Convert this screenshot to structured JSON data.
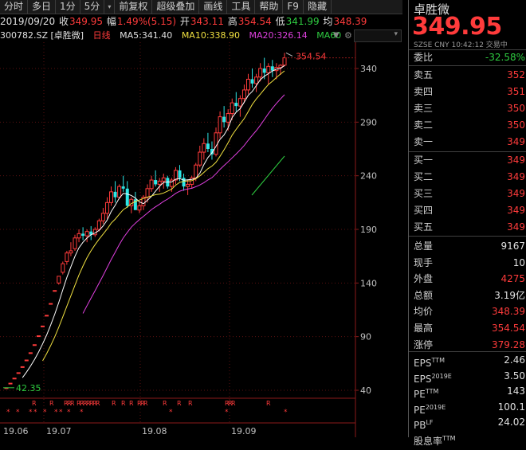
{
  "toolbar": {
    "items": [
      "分时",
      "多日",
      "1分",
      "5分",
      "▾",
      "前复权",
      "超级叠加",
      "画线",
      "工具",
      "帮助",
      "F9",
      "隐藏"
    ]
  },
  "quote": {
    "date": "2019/09/20",
    "close_label": "收",
    "close": "349.95",
    "change_label": "幅",
    "change": "1.49%(5.15)",
    "open_label": "开",
    "open": "343.11",
    "high_label": "高",
    "high": "354.54",
    "low_label": "低",
    "low": "341.99",
    "avg_label": "均",
    "avg": "348.39"
  },
  "ma": {
    "code": "300782.SZ [卓胜微]",
    "period": "日线",
    "ma5": "MA5:341.40",
    "ma10": "MA10:338.90",
    "ma20": "MA20:326.14",
    "ma60": "MA60",
    "colors": {
      "ma5": "#ffffff",
      "ma10": "#f0e040",
      "ma20": "#e040e0",
      "ma60": "#2ecc40"
    }
  },
  "chart_data": {
    "type": "candlestick",
    "y_ticks": [
      340,
      290,
      240,
      190,
      140,
      90,
      40
    ],
    "ylim": [
      30,
      370
    ],
    "x_ticks": [
      "19.06",
      "19.07",
      "19.08",
      "19.09"
    ],
    "high_marker": "354.54",
    "low_marker": "42.35",
    "candles": [
      [
        42.35,
        42.35,
        42.35,
        42.35
      ],
      [
        46.6,
        46.6,
        46.6,
        46.6
      ],
      [
        51.3,
        51.3,
        51.3,
        51.3
      ],
      [
        56.4,
        56.4,
        56.4,
        56.4
      ],
      [
        62.0,
        62.0,
        62.0,
        62.0
      ],
      [
        68.2,
        68.2,
        68.2,
        68.2
      ],
      [
        75.0,
        75.0,
        75.0,
        75.0
      ],
      [
        82.5,
        82.5,
        82.5,
        82.5
      ],
      [
        90.8,
        90.8,
        90.8,
        90.8
      ],
      [
        99.9,
        99.9,
        99.9,
        99.9
      ],
      [
        109.9,
        109.9,
        109.9,
        109.9
      ],
      [
        120.9,
        120.9,
        120.9,
        120.9
      ],
      [
        133.0,
        133.0,
        133.0,
        133.0
      ],
      [
        140.0,
        146.3,
        138.5,
        146.3
      ],
      [
        150,
        160,
        148,
        158
      ],
      [
        160,
        170,
        157,
        168
      ],
      [
        168,
        178,
        165,
        170
      ],
      [
        172,
        185,
        170,
        182
      ],
      [
        182,
        190,
        178,
        186
      ],
      [
        186,
        192,
        180,
        184
      ],
      [
        184,
        190,
        178,
        188
      ],
      [
        188,
        193,
        180,
        185
      ],
      [
        185,
        192,
        183,
        190
      ],
      [
        190,
        200,
        188,
        198
      ],
      [
        198,
        210,
        195,
        205
      ],
      [
        205,
        220,
        200,
        215
      ],
      [
        215,
        230,
        212,
        225
      ],
      [
        225,
        235,
        215,
        220
      ],
      [
        220,
        232,
        218,
        230
      ],
      [
        230,
        240,
        225,
        228
      ],
      [
        228,
        235,
        210,
        212
      ],
      [
        212,
        220,
        205,
        218
      ],
      [
        218,
        225,
        210,
        208
      ],
      [
        208,
        215,
        205,
        212
      ],
      [
        212,
        222,
        208,
        220
      ],
      [
        220,
        232,
        215,
        228
      ],
      [
        228,
        240,
        225,
        236
      ],
      [
        236,
        245,
        230,
        232
      ],
      [
        232,
        238,
        225,
        235
      ],
      [
        235,
        242,
        228,
        238
      ],
      [
        238,
        240,
        228,
        230
      ],
      [
        230,
        238,
        225,
        236
      ],
      [
        236,
        248,
        232,
        245
      ],
      [
        245,
        250,
        235,
        238
      ],
      [
        238,
        242,
        226,
        230
      ],
      [
        230,
        236,
        222,
        232
      ],
      [
        232,
        240,
        228,
        238
      ],
      [
        238,
        252,
        235,
        250
      ],
      [
        250,
        268,
        248,
        262
      ],
      [
        262,
        275,
        255,
        270
      ],
      [
        270,
        280,
        262,
        265
      ],
      [
        265,
        272,
        255,
        260
      ],
      [
        260,
        285,
        258,
        280
      ],
      [
        280,
        300,
        275,
        295
      ],
      [
        295,
        305,
        285,
        290
      ],
      [
        290,
        302,
        282,
        298
      ],
      [
        298,
        312,
        292,
        308
      ],
      [
        308,
        318,
        300,
        305
      ],
      [
        305,
        315,
        295,
        312
      ],
      [
        312,
        325,
        308,
        320
      ],
      [
        320,
        335,
        316,
        330
      ],
      [
        330,
        340,
        322,
        326
      ],
      [
        326,
        335,
        318,
        332
      ],
      [
        332,
        345,
        328,
        340
      ],
      [
        340,
        350,
        330,
        336
      ],
      [
        336,
        345,
        325,
        342
      ],
      [
        342,
        348,
        332,
        338
      ],
      [
        338,
        345,
        330,
        341
      ],
      [
        341,
        344,
        334,
        343
      ],
      [
        343.11,
        354.54,
        341.99,
        349.95
      ]
    ]
  },
  "right_panel": {
    "name": "卓胜微",
    "price": "349.95",
    "sub": "SZSE  CNY  10:42:12  交易中",
    "weibi_label": "委比",
    "weibi": "-32.58%",
    "asks": [
      {
        "label": "卖五",
        "price": "352"
      },
      {
        "label": "卖四",
        "price": "351"
      },
      {
        "label": "卖三",
        "price": "350"
      },
      {
        "label": "卖二",
        "price": "350"
      },
      {
        "label": "卖一",
        "price": "349"
      }
    ],
    "bids": [
      {
        "label": "买一",
        "price": "349"
      },
      {
        "label": "买二",
        "price": "349"
      },
      {
        "label": "买三",
        "price": "349"
      },
      {
        "label": "买四",
        "price": "349"
      },
      {
        "label": "买五",
        "price": "349"
      }
    ],
    "stats": [
      {
        "label": "总量",
        "value": "9167",
        "color": "#e0e0e0"
      },
      {
        "label": "现手",
        "value": "10",
        "color": "#e0e0e0"
      },
      {
        "label": "外盘",
        "value": "4275",
        "color": "#ff3b3b"
      },
      {
        "label": "总额",
        "value": "3.19亿",
        "color": "#e0e0e0"
      },
      {
        "label": "均价",
        "value": "348.39",
        "color": "#ff3b3b"
      },
      {
        "label": "最高",
        "value": "354.54",
        "color": "#ff3b3b"
      },
      {
        "label": "涨停",
        "value": "379.28",
        "color": "#ff3b3b"
      }
    ],
    "fund": [
      {
        "label": "EPS",
        "sup": "TTM",
        "value": "2.46"
      },
      {
        "label": "EPS",
        "sup": "2019E",
        "value": "3.50"
      },
      {
        "label": "PE",
        "sup": "TTM",
        "value": "143"
      },
      {
        "label": "PE",
        "sup": "2019E",
        "value": "100.1"
      },
      {
        "label": "PB",
        "sup": "LF",
        "value": "24.02"
      },
      {
        "label": "股息率",
        "sup": "TTM",
        "value": ""
      }
    ]
  }
}
